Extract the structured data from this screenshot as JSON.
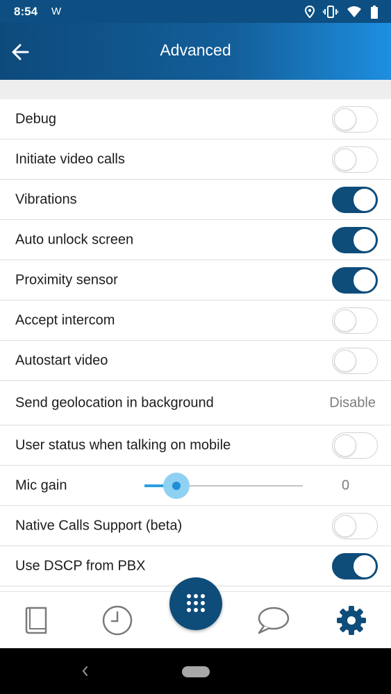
{
  "status_bar": {
    "time": "8:54",
    "notification": "W"
  },
  "header": {
    "title": "Advanced"
  },
  "settings": [
    {
      "label": "Debug",
      "toggle": false
    },
    {
      "label": "Initiate video calls",
      "toggle": false
    },
    {
      "label": "Vibrations",
      "toggle": true
    },
    {
      "label": "Auto unlock screen",
      "toggle": true
    },
    {
      "label": "Proximity sensor",
      "toggle": true
    },
    {
      "label": "Accept intercom",
      "toggle": false
    },
    {
      "label": "Autostart video",
      "toggle": false
    },
    {
      "label": "Send geolocation in background",
      "value": "Disable"
    },
    {
      "label": "User status when talking on mobile",
      "toggle": false
    },
    {
      "label": "Mic gain",
      "slider_fraction": 0.2,
      "value": "0"
    },
    {
      "label": "Native Calls Support (beta)",
      "toggle": false
    },
    {
      "label": "Use DSCP from PBX",
      "toggle": true
    }
  ],
  "bottom_nav": {
    "items": [
      "contacts-book-icon",
      "history-clock-icon",
      "dialpad-icon",
      "chat-bubble-icon",
      "settings-gear-icon"
    ],
    "active": "settings-gear-icon"
  },
  "colors": {
    "accent": "#0e4c7a",
    "header_gradient_start": "#0d4a7c",
    "header_gradient_end": "#1e8ee0",
    "slider": "#29a0e0"
  }
}
